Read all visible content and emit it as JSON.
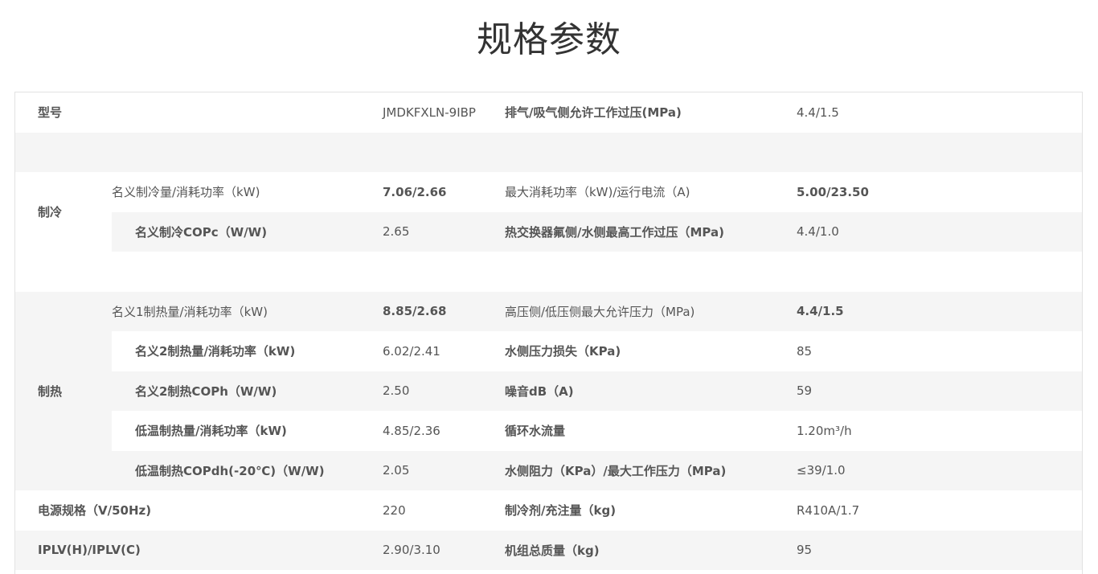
{
  "title": "规格参数",
  "model": {
    "label": "型号",
    "value": "JMDKFXLN-9IBP",
    "param": "排气/吸气侧允许工作过压(MPa)",
    "param_value": "4.4/1.5"
  },
  "cooling": {
    "label": "制冷",
    "rows": [
      {
        "name": "名义制冷量/消耗功率（kW)",
        "value": "7.06/2.66",
        "param": "最大消耗功率（kW)/运行电流（A)",
        "param_value": "5.00/23.50"
      },
      {
        "name": "名义制冷COPc（W/W)",
        "value": "2.65",
        "param": "热交换器氟侧/水侧最高工作过压（MPa)",
        "param_value": "4.4/1.0"
      }
    ]
  },
  "heating": {
    "label": "制热",
    "rows": [
      {
        "name": "名义1制热量/消耗功率（kW)",
        "value": "8.85/2.68",
        "param": "高压侧/低压侧最大允许压力（MPa)",
        "param_value": "4.4/1.5"
      },
      {
        "name": "名义2制热量/消耗功率（kW)",
        "value": "6.02/2.41",
        "param": "水侧压力损失（KPa)",
        "param_value": "85"
      },
      {
        "name": "名义2制热COPh（W/W)",
        "value": "2.50",
        "param": "噪音dB（A)",
        "param_value": "59"
      },
      {
        "name": "低温制热量/消耗功率（kW)",
        "value": "4.85/2.36",
        "param": "循环水流量",
        "param_value": "1.20m³/h"
      },
      {
        "name": "低温制热COPdh(-20℃)（W/W)",
        "value": "2.05",
        "param": "水侧阻力（KPa）/最大工作压力（MPa)",
        "param_value": "≤39/1.0"
      }
    ]
  },
  "power": {
    "label": "电源规格（V/50Hz)",
    "value": "220",
    "param": "制冷剂/充注量（kg)",
    "param_value": "R410A/1.7"
  },
  "iplv": {
    "label": "IPLV(H)/IPLV(C)",
    "value": "2.90/3.10",
    "param": "机组总质量（kg)",
    "param_value": "95"
  }
}
